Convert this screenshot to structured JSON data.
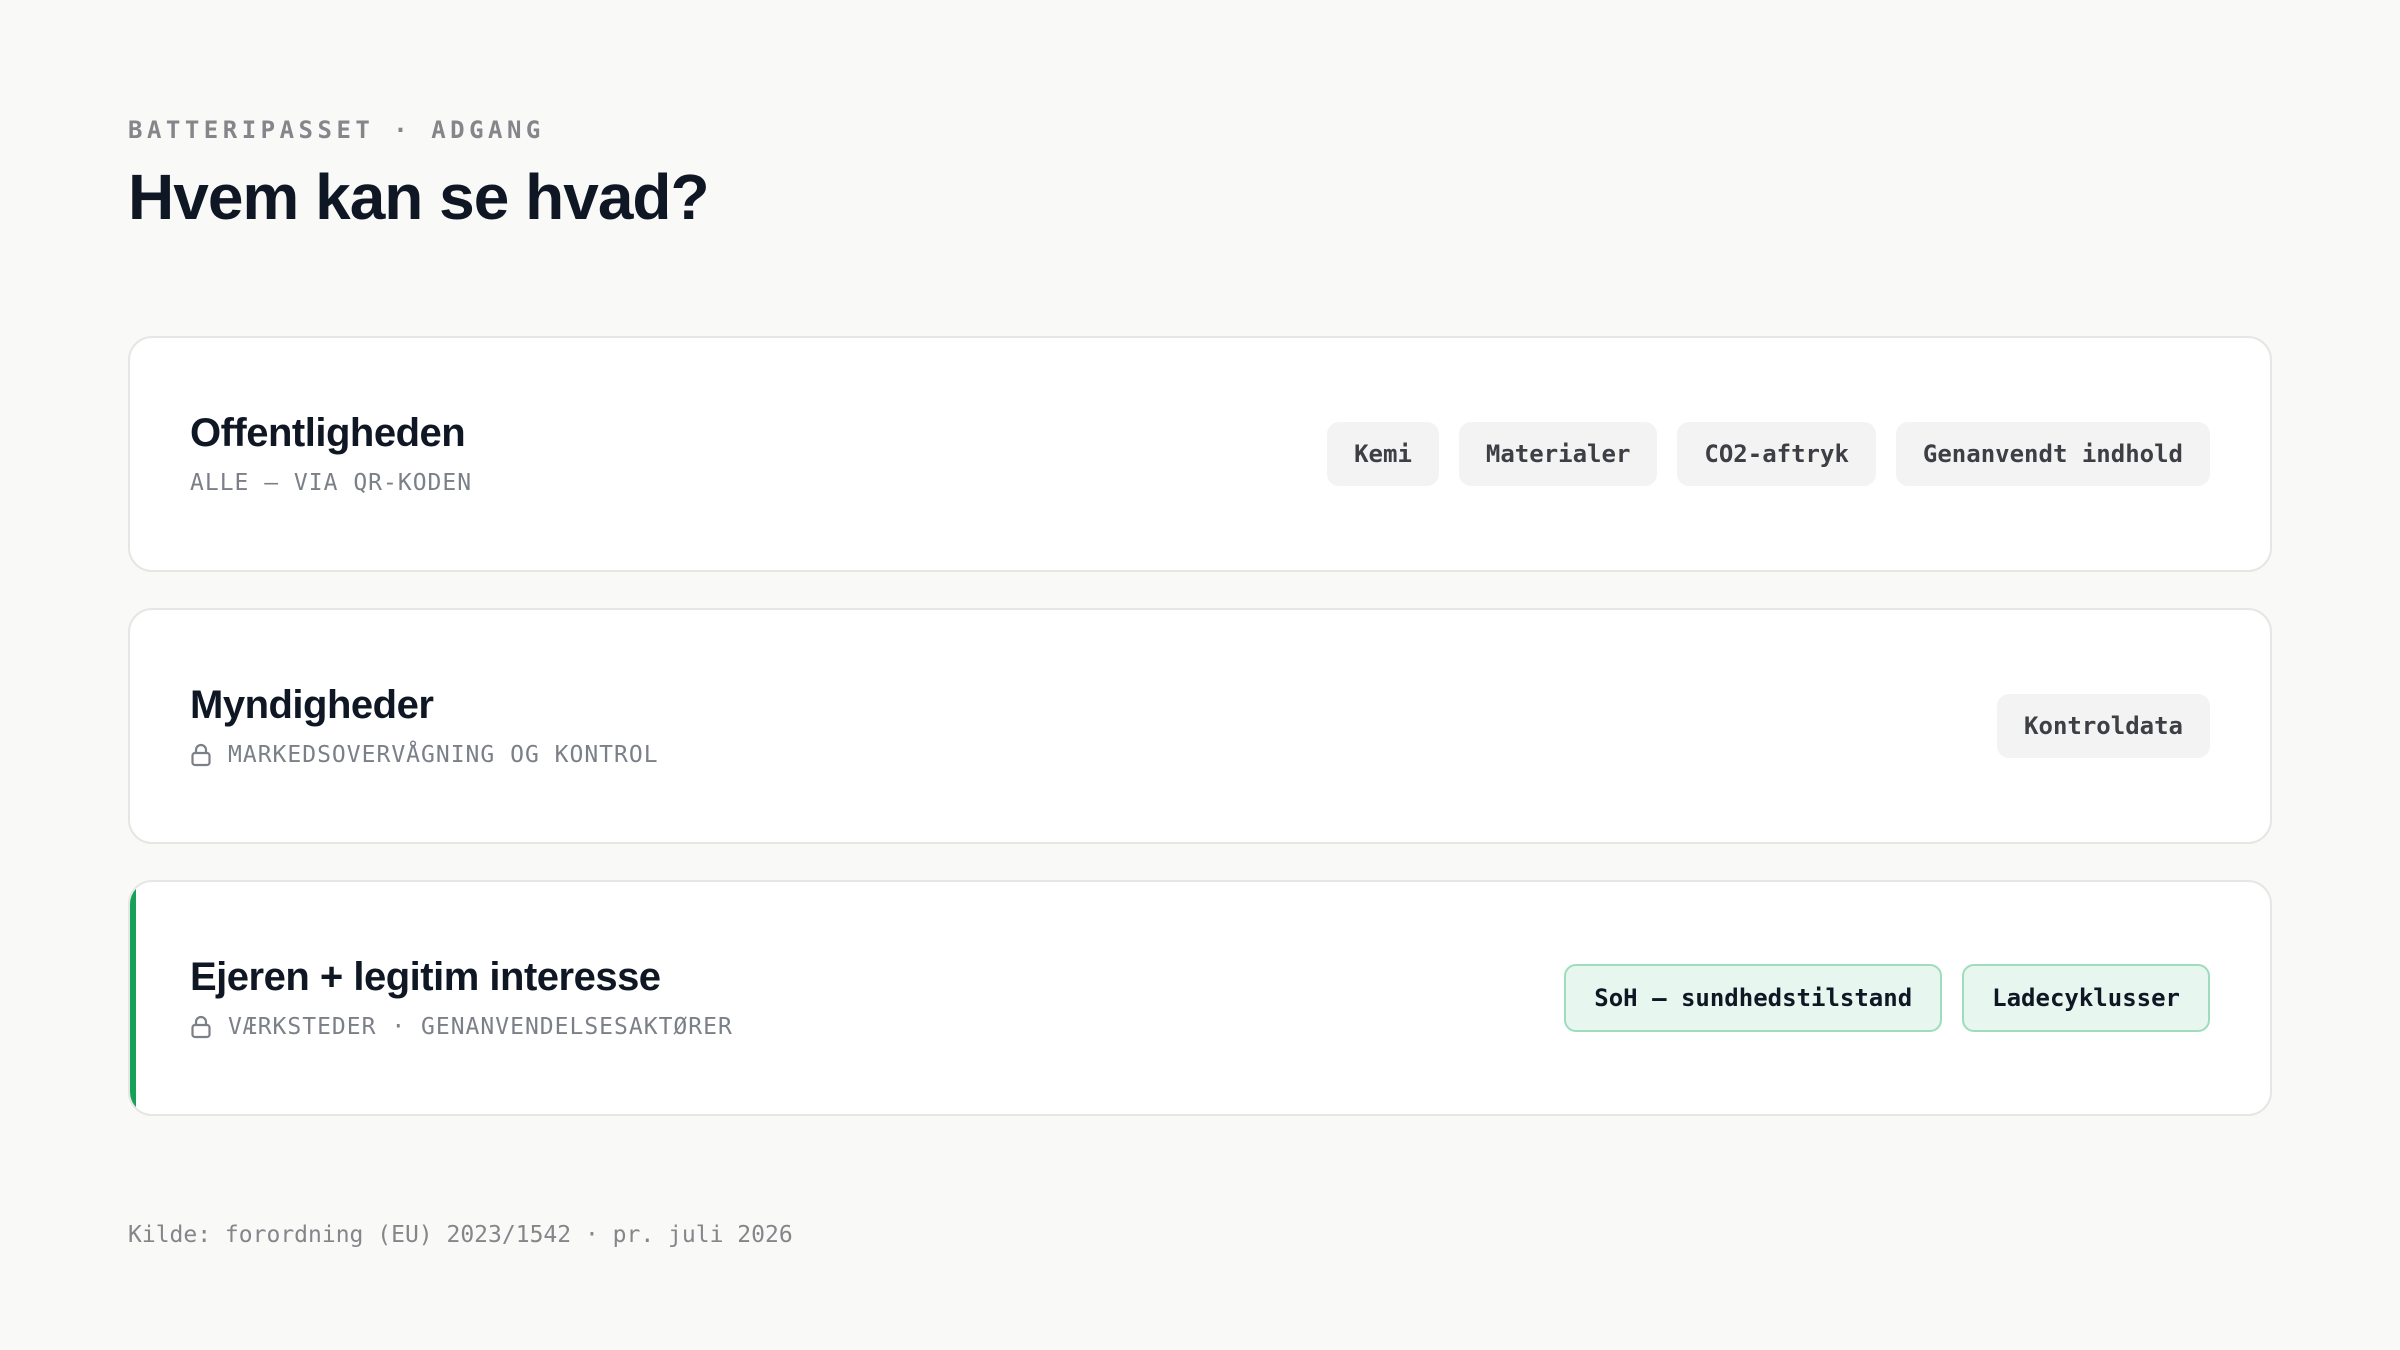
{
  "header": {
    "eyebrow": "BATTERIPASSET · ADGANG",
    "title": "Hvem kan se hvad?"
  },
  "cards": [
    {
      "title": "Offentligheden",
      "subtitle": "ALLE — VIA QR-KODEN",
      "locked": false,
      "chips": [
        "Kemi",
        "Materialer",
        "CO2-aftryk",
        "Genanvendt indhold"
      ]
    },
    {
      "title": "Myndigheder",
      "subtitle": "MARKEDSOVERVÅGNING OG KONTROL",
      "locked": true,
      "icon": "lock-icon",
      "chips": [
        "Kontroldata"
      ]
    },
    {
      "title": "Ejeren + legitim interesse",
      "subtitle": "VÆRKSTEDER · GENANVENDELSESAKTØRER",
      "locked": true,
      "icon": "lock-icon",
      "highlighted": true,
      "chips": [
        "SoH — sundhedstilstand",
        "Ladecyklusser"
      ]
    }
  ],
  "footer": {
    "source": "Kilde: forordning (EU) 2023/1542 · pr. juli 2026"
  },
  "colors": {
    "accent": "#16a05a",
    "background": "#f9f9f8",
    "chip": "#f3f3f3",
    "chip_green": "#e7f6ee"
  }
}
